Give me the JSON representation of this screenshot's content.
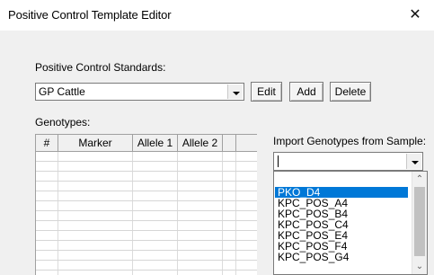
{
  "window": {
    "title": "Positive Control Template Editor",
    "close_glyph": "✕"
  },
  "standards": {
    "label": "Positive Control Standards:",
    "selected": "GP Cattle",
    "buttons": {
      "edit": "Edit",
      "add": "Add",
      "delete": "Delete"
    }
  },
  "genotypes": {
    "label": "Genotypes:",
    "columns": [
      "#",
      "Marker",
      "Allele 1",
      "Allele 2",
      ""
    ]
  },
  "import": {
    "label": "Import Genotypes from Sample:",
    "value": "",
    "options": [
      "PKO_D4",
      "KPC_POS_A4",
      "KPC_POS_B4",
      "KPC_POS_C4",
      "KPC_POS_E4",
      "KPC_POS_F4",
      "KPC_POS_G4"
    ],
    "selected_index": 0
  },
  "icons": {
    "close": "close-icon",
    "dropdown": "chevron-down-icon",
    "scroll_up": "scroll-up-icon",
    "scroll_down": "scroll-down-icon"
  },
  "colors": {
    "selection": "#0078d7",
    "window_bg": "#f0f0f0"
  }
}
